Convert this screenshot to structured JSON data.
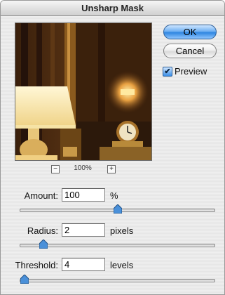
{
  "window": {
    "title": "Unsharp Mask"
  },
  "preview": {
    "zoom_level": "100%",
    "zoom_out_symbol": "−",
    "zoom_in_symbol": "+",
    "show_preview_label": "Preview",
    "show_preview_checked": true,
    "checkmark": "✔"
  },
  "buttons": {
    "ok_label": "OK",
    "cancel_label": "Cancel"
  },
  "fields": {
    "amount": {
      "label": "Amount:",
      "value": "100",
      "unit": "%",
      "slider_fraction": 0.5
    },
    "radius": {
      "label": "Radius:",
      "value": "2",
      "unit": "pixels",
      "slider_fraction": 0.1
    },
    "threshold": {
      "label": "Threshold:",
      "value": "4",
      "unit": "levels",
      "slider_fraction": 0.0
    }
  },
  "colors": {
    "ok_accent": "#3a8ee6",
    "slider_thumb": "#4a90d9"
  }
}
